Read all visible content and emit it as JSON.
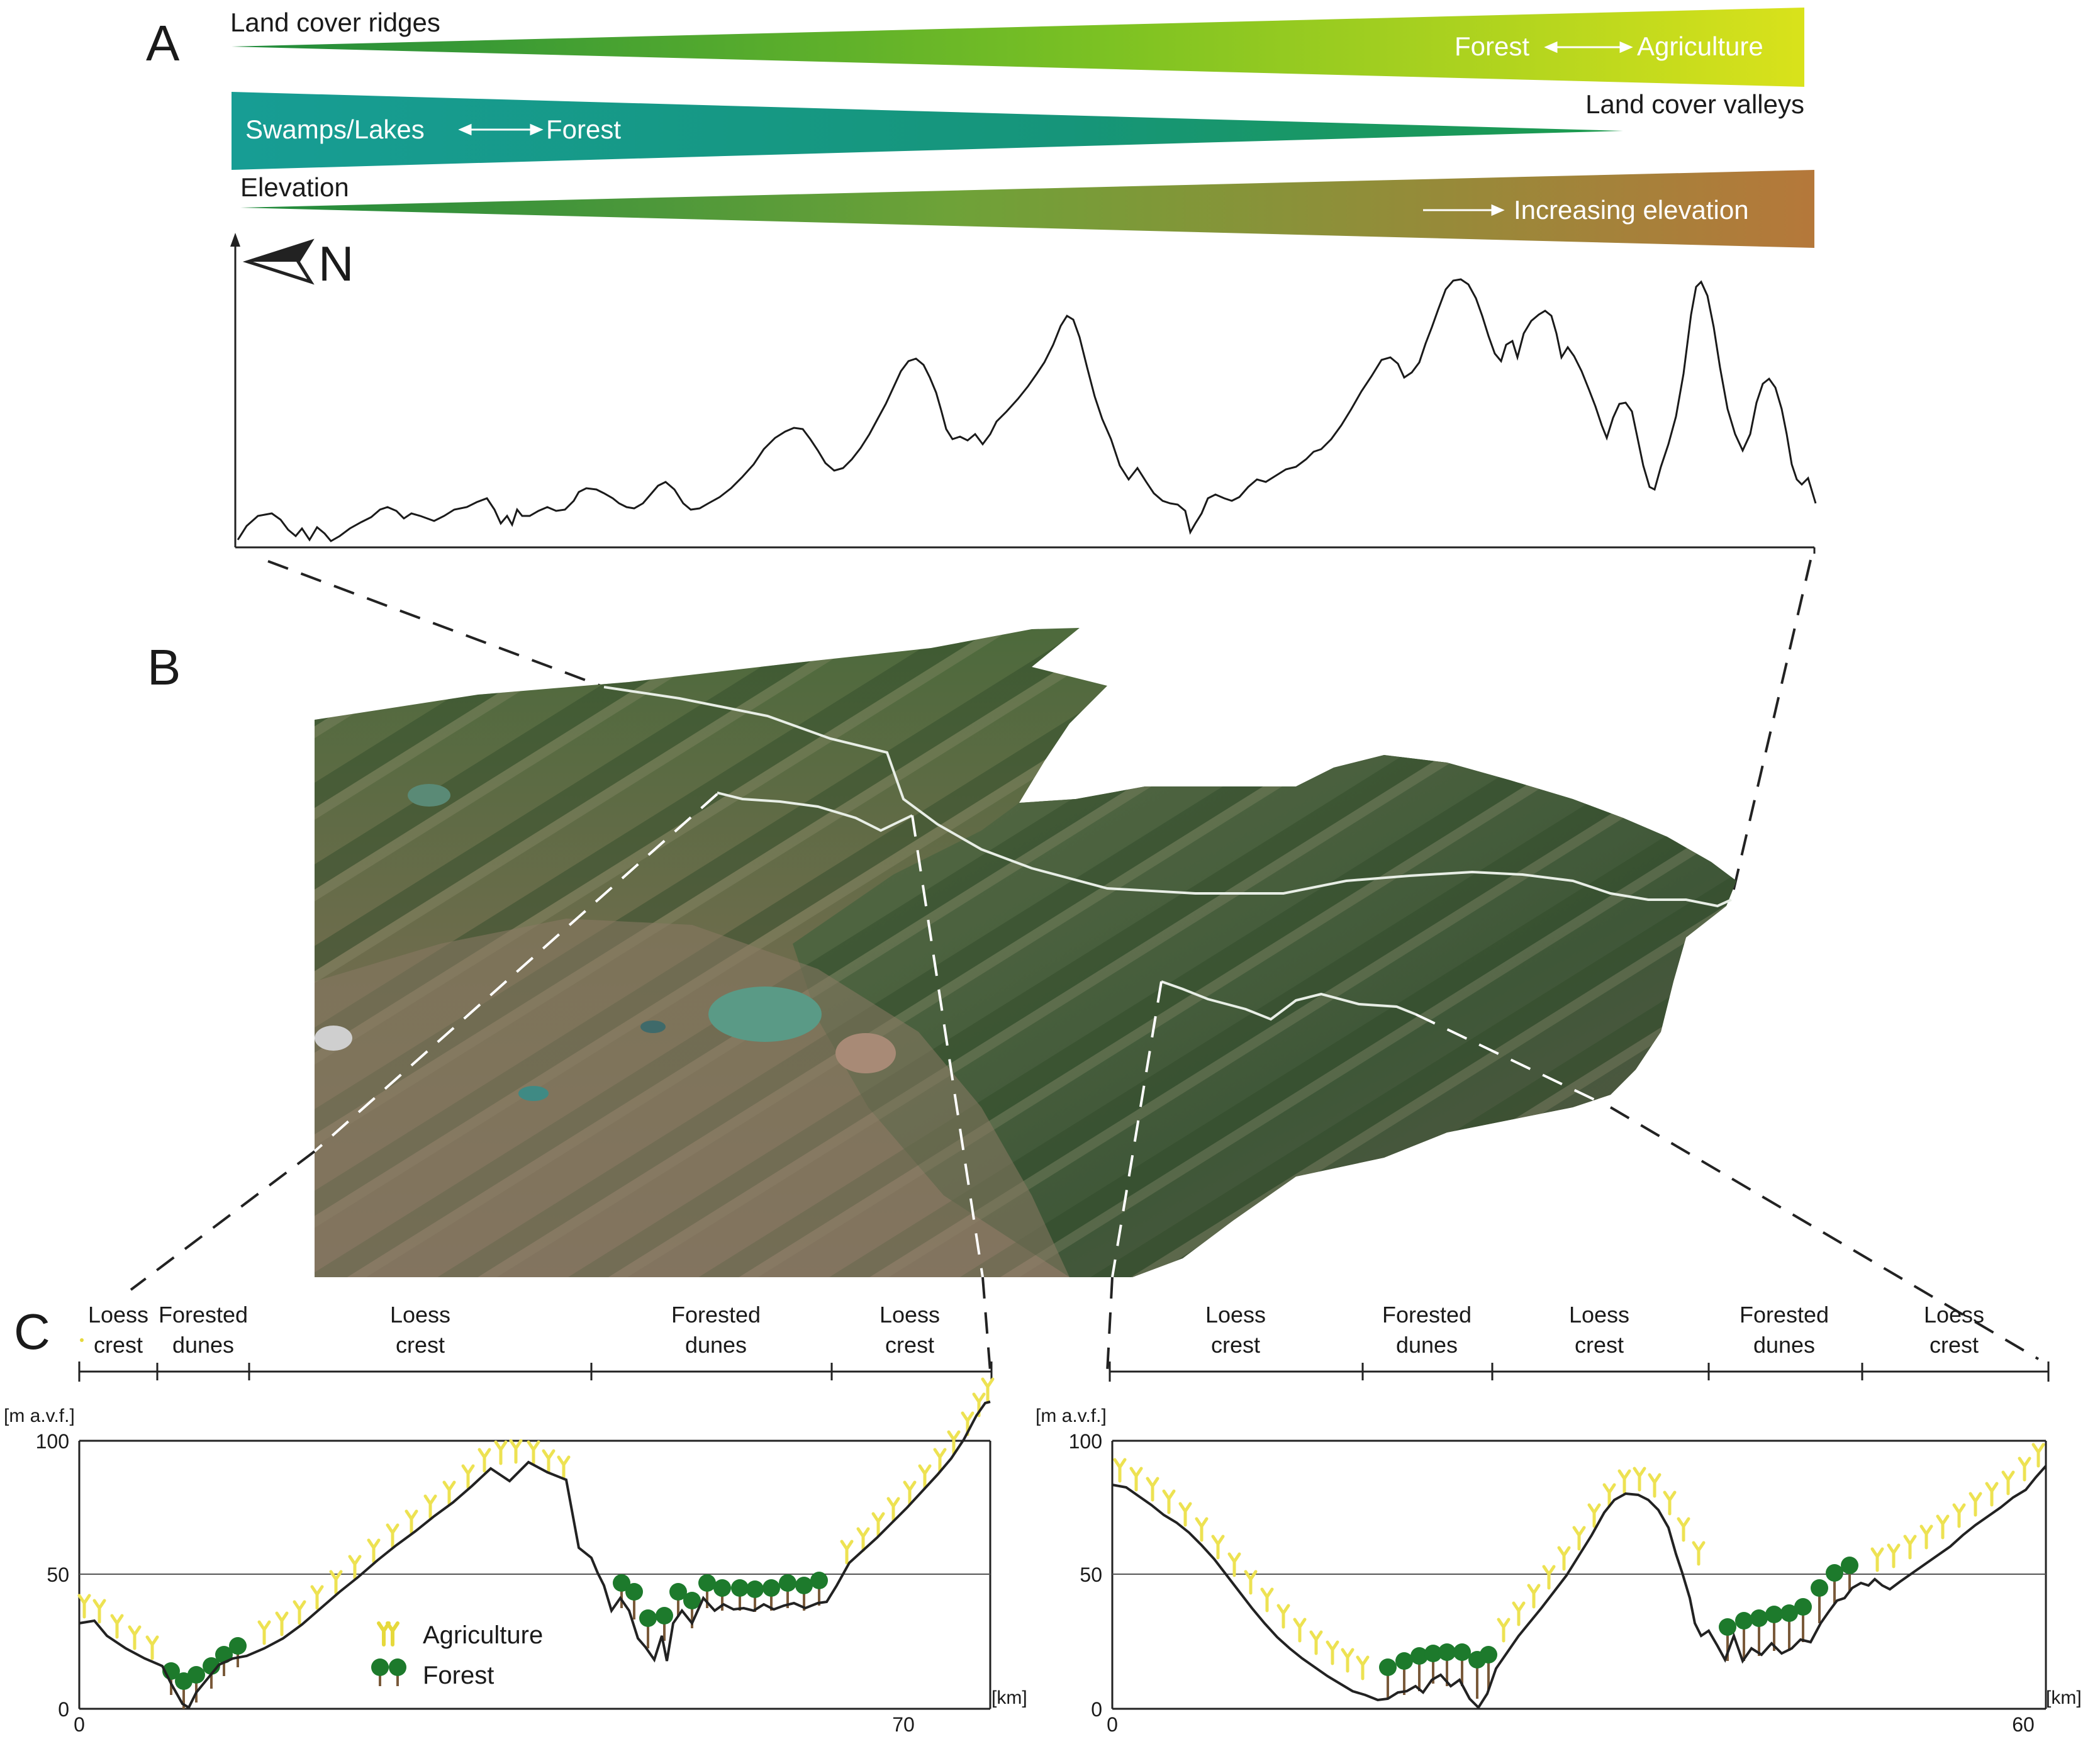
{
  "panels": {
    "a": "A",
    "b": "B",
    "c": "C"
  },
  "gradients": {
    "ridges": {
      "label": "Land cover ridges",
      "range_from": "Forest",
      "range_to": "Agriculture"
    },
    "valleys": {
      "label": "Land cover valleys",
      "range_from": "Swamps/Lakes",
      "range_to": "Forest"
    },
    "elevation": {
      "label": "Elevation",
      "range_to": "Increasing elevation"
    }
  },
  "north": {
    "label": "N"
  },
  "profile_c": {
    "left": {
      "segments": [
        {
          "line1": "Loess",
          "line2": "crest"
        },
        {
          "line1": "Forested",
          "line2": "dunes"
        },
        {
          "line1": "Loess",
          "line2": "crest"
        },
        {
          "line1": "Forested",
          "line2": "dunes"
        },
        {
          "line1": "Loess",
          "line2": "crest"
        }
      ],
      "y_unit": "[m a.v.f.]",
      "x_unit": "[km]",
      "y_ticks": [
        "100",
        "50",
        "0"
      ],
      "x_ticks": [
        "0",
        "70"
      ]
    },
    "right": {
      "segments": [
        {
          "line1": "Loess",
          "line2": "crest"
        },
        {
          "line1": "Forested",
          "line2": "dunes"
        },
        {
          "line1": "Loess",
          "line2": "crest"
        },
        {
          "line1": "Forested",
          "line2": "dunes"
        },
        {
          "line1": "Loess",
          "line2": "crest"
        }
      ],
      "y_unit": "[m a.v.f.]",
      "x_unit": "[km]",
      "y_ticks": [
        "100",
        "50",
        "0"
      ],
      "x_ticks": [
        "0",
        "60"
      ]
    }
  },
  "legend": {
    "agriculture": "Agriculture",
    "forest": "Forest"
  },
  "colors": {
    "ridge_gradient": [
      "#1f8a3c",
      "#d7e31a"
    ],
    "valley_gradient": [
      "#169a8e",
      "#1c9a4a"
    ],
    "elevation_gradient": [
      "#1f8a3c",
      "#b87a3a"
    ],
    "agriculture_marker": "#f2e84a",
    "forest_marker": "#1d7a2c"
  },
  "icons": [
    "north-arrow-icon",
    "agriculture-marker-icon",
    "forest-marker-icon"
  ]
}
